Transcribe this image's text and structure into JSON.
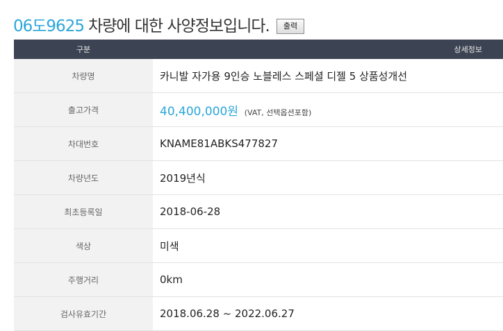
{
  "header": {
    "plate": "06도9625",
    "title_suffix": "차량에 대한 사양정보입니다.",
    "print_label": "출력"
  },
  "table": {
    "col_label": "구분",
    "col_value": "상세정보",
    "rows": [
      {
        "label": "차량명",
        "value": "카니발 자가용 9인승 노블레스 스페셜 디젤 5 상품성개선"
      },
      {
        "label": "출고가격",
        "value": "40,400,000원",
        "note": "(VAT, 선택옵션포함)"
      },
      {
        "label": "차대번호",
        "value": "KNAME81ABKS477827"
      },
      {
        "label": "차량년도",
        "value": "2019년식"
      },
      {
        "label": "최초등록일",
        "value": "2018-06-28"
      },
      {
        "label": "색상",
        "value": "미색"
      },
      {
        "label": "주행거리",
        "value": "0km"
      },
      {
        "label": "검사유효기간",
        "value": "2018.06.28 ~ 2022.06.27"
      }
    ]
  },
  "colors": {
    "accent": "#2ba6d9",
    "header_bg": "#3c4352",
    "label_bg": "#f2f2f2"
  }
}
